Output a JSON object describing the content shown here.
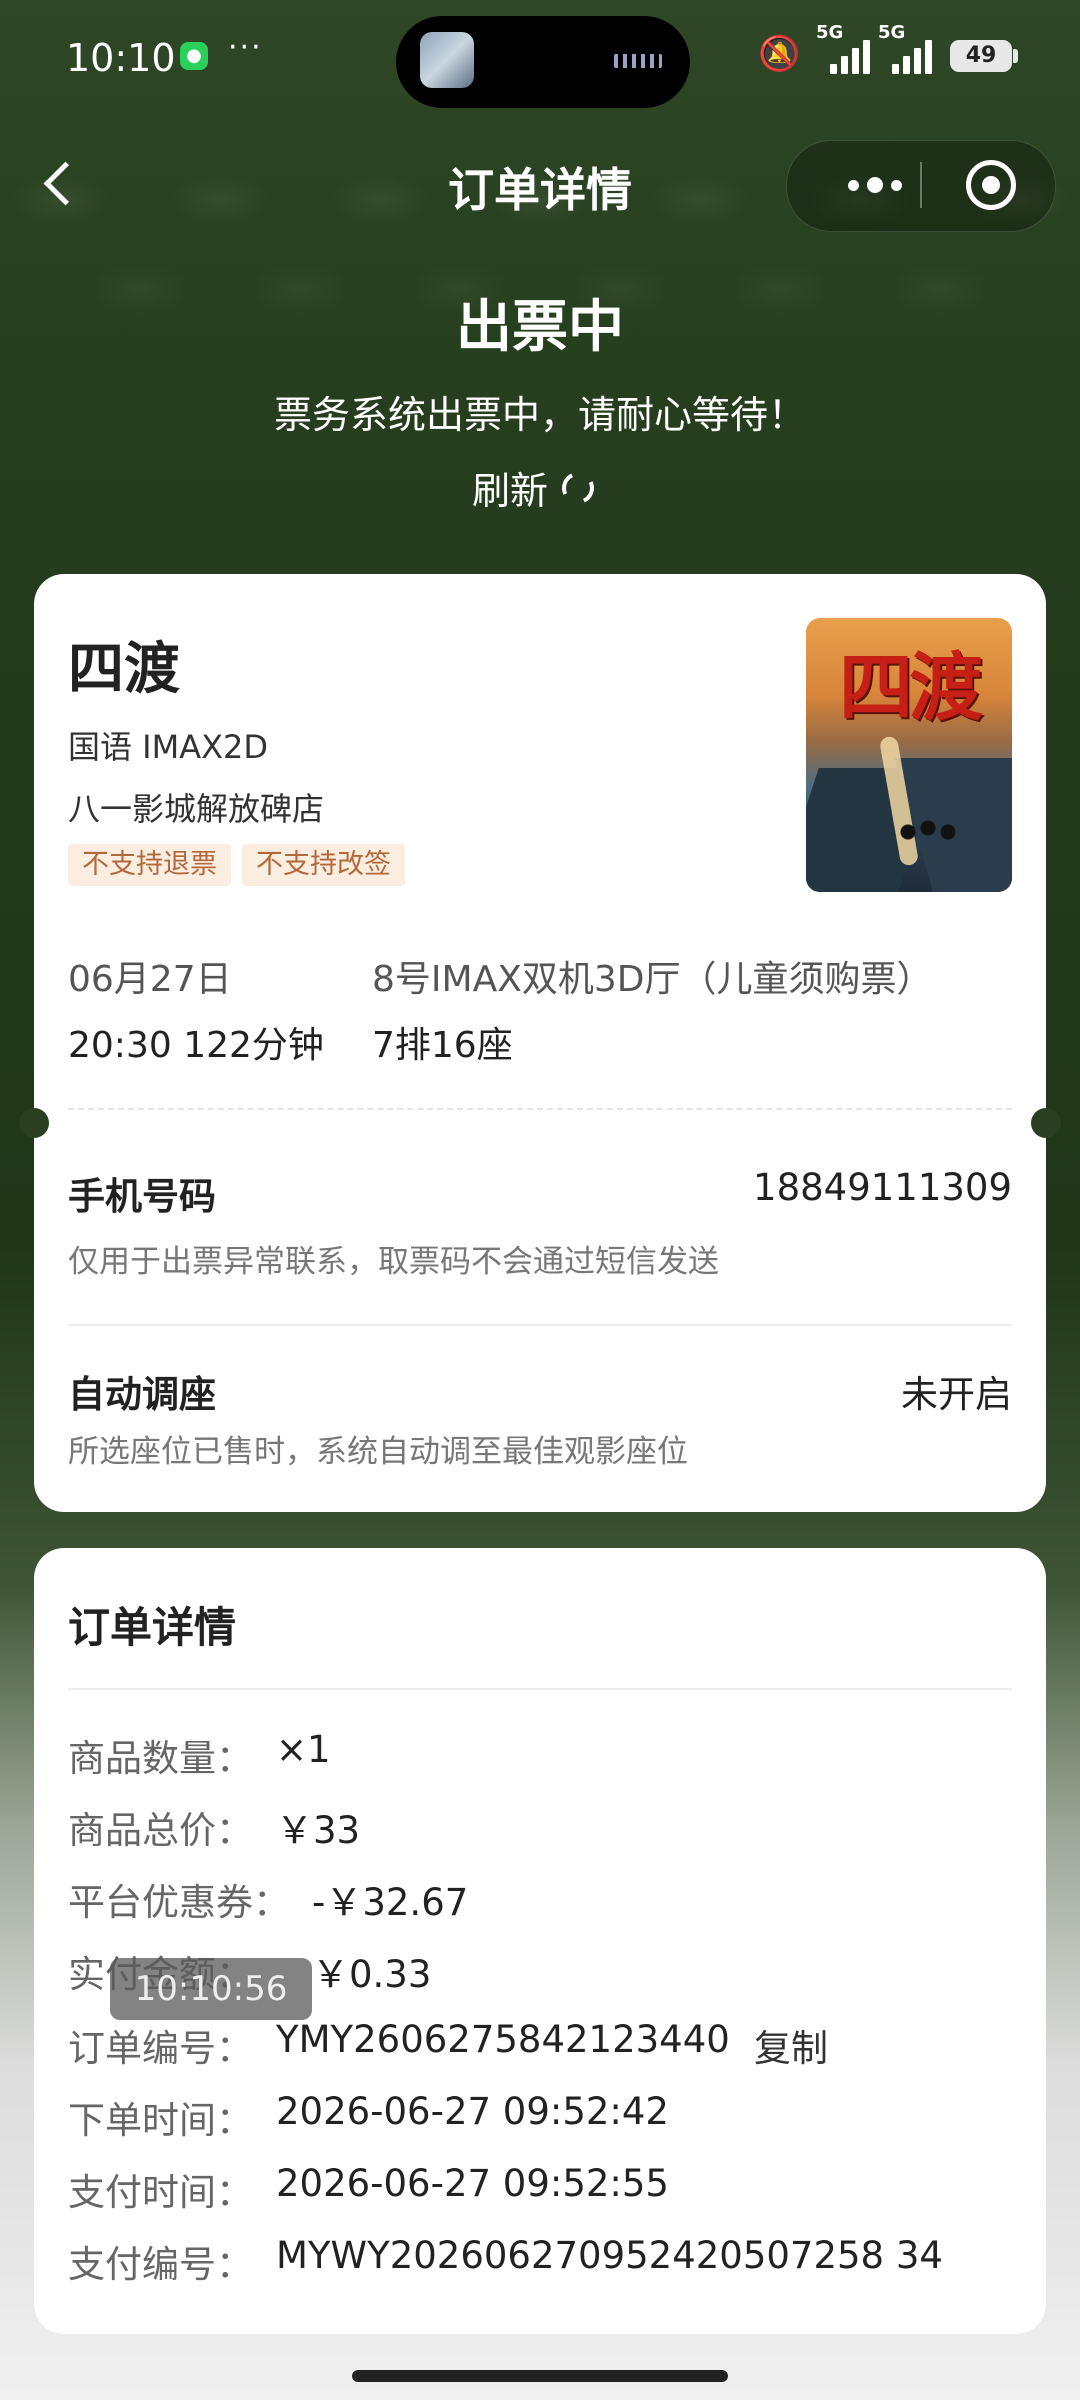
{
  "status_bar": {
    "time": "10:10",
    "more": "···",
    "battery": "49",
    "net1": "5G",
    "net2": "5G"
  },
  "nav": {
    "title": "订单详情"
  },
  "header": {
    "status": "出票中",
    "description": "票务系统出票中，请耐心等待！",
    "refresh_label": "刷新"
  },
  "ticket": {
    "movie_title": "四渡",
    "language_format": "国语 IMAX2D",
    "cinema": "八一影城解放碑店",
    "tags": [
      "不支持退票",
      "不支持改签"
    ],
    "poster_title": "四渡",
    "date": "06月27日",
    "hall": "8号IMAX双机3D厅（儿童须购票）",
    "time_duration": "20:30 122分钟",
    "seat": "7排16座",
    "phone_label": "手机号码",
    "phone_value": "18849111309",
    "phone_hint": "仅用于出票异常联系，取票码不会通过短信发送",
    "auto_seat_label": "自动调座",
    "auto_seat_value": "未开启",
    "auto_seat_hint": "所选座位已售时，系统自动调至最佳观影座位"
  },
  "order": {
    "title": "订单详情",
    "rows": [
      {
        "label": "商品数量：",
        "value": "×1"
      },
      {
        "label": "商品总价：",
        "value": "￥33"
      },
      {
        "label": "平台优惠券：",
        "value": "-￥32.67"
      },
      {
        "label": "实付金额：",
        "value": "￥0.33"
      },
      {
        "label": "订单编号：",
        "value": "YMY2606275842123440"
      },
      {
        "label": "下单时间：",
        "value": "2026-06-27 09:52:42"
      },
      {
        "label": "支付时间：",
        "value": "2026-06-27 09:52:55"
      },
      {
        "label": "支付编号：",
        "value": "MYWY202606270952420507258 34"
      }
    ],
    "copy_label": "复制"
  },
  "overlay_timestamp": "10:10:56",
  "colors": {
    "header_green": "#27401f",
    "tag_bg": "#fbeee0",
    "tag_text": "#b2683b"
  }
}
